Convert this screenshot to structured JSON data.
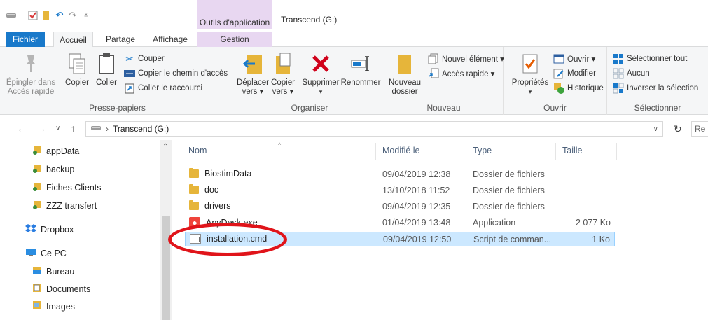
{
  "window": {
    "context_tab_group": "Outils d'application",
    "title": "Transcend (G:)"
  },
  "tabs": {
    "fichier": "Fichier",
    "accueil": "Accueil",
    "partage": "Partage",
    "affichage": "Affichage",
    "gestion": "Gestion"
  },
  "ribbon": {
    "presse_papiers": {
      "label": "Presse-papiers",
      "epingler": "Épingler dans Accès rapide",
      "epingler_l1": "Épingler dans",
      "epingler_l2": "Accès rapide",
      "copier": "Copier",
      "coller": "Coller",
      "couper": "Couper",
      "copier_chemin": "Copier le chemin d'accès",
      "coller_raccourci": "Coller le raccourci"
    },
    "organiser": {
      "label": "Organiser",
      "deplacer_l1": "Déplacer",
      "deplacer_l2": "vers ▾",
      "copier_l1": "Copier",
      "copier_l2": "vers ▾",
      "supprimer": "Supprimer",
      "renommer": "Renommer"
    },
    "nouveau": {
      "label": "Nouveau",
      "nouveau_dossier_l1": "Nouveau",
      "nouveau_dossier_l2": "dossier",
      "nouvel_element": "Nouvel élément ▾",
      "acces_rapide": "Accès rapide ▾"
    },
    "ouvrir": {
      "label": "Ouvrir",
      "proprietes": "Propriétés",
      "ouvrir": "Ouvrir ▾",
      "modifier": "Modifier",
      "historique": "Historique"
    },
    "selectionner": {
      "label": "Sélectionner",
      "tout": "Sélectionner tout",
      "aucun": "Aucun",
      "inverser": "Inverser la sélection"
    }
  },
  "address": {
    "path": "Transcend (G:)",
    "search_partial": "Re"
  },
  "navpane": {
    "items": [
      {
        "label": "appData",
        "icon": "folder-pinned-icon"
      },
      {
        "label": "backup",
        "icon": "folder-pinned-icon"
      },
      {
        "label": "Fiches Clients",
        "icon": "folder-pinned-icon"
      },
      {
        "label": "ZZZ transfert",
        "icon": "folder-pinned-icon"
      },
      {
        "label": "Dropbox",
        "icon": "dropbox-icon"
      },
      {
        "label": "Ce PC",
        "icon": "computer-icon"
      },
      {
        "label": "Bureau",
        "icon": "desktop-icon"
      },
      {
        "label": "Documents",
        "icon": "documents-icon"
      },
      {
        "label": "Images",
        "icon": "images-icon"
      }
    ]
  },
  "filelist": {
    "columns": {
      "name": "Nom",
      "modified": "Modifié le",
      "type": "Type",
      "size": "Taille"
    },
    "rows": [
      {
        "name": "BiostimData",
        "modified": "09/04/2019 12:38",
        "type": "Dossier de fichiers",
        "size": "",
        "icon": "folder-icon"
      },
      {
        "name": "doc",
        "modified": "13/10/2018 11:52",
        "type": "Dossier de fichiers",
        "size": "",
        "icon": "folder-icon"
      },
      {
        "name": "drivers",
        "modified": "09/04/2019 12:35",
        "type": "Dossier de fichiers",
        "size": "",
        "icon": "folder-icon"
      },
      {
        "name": "AnyDesk.exe",
        "modified": "01/04/2019 13:48",
        "type": "Application",
        "size": "2 077 Ko",
        "icon": "anydesk-icon"
      },
      {
        "name": "installation.cmd",
        "modified": "09/04/2019 12:50",
        "type": "Script de comman...",
        "size": "1 Ko",
        "icon": "cmd-script-icon",
        "selected": true
      }
    ]
  },
  "colors": {
    "accent": "#1979ca",
    "selection": "#cce8ff",
    "context_tab": "#e8d7f1",
    "highlight_ellipse": "#e0141a"
  }
}
